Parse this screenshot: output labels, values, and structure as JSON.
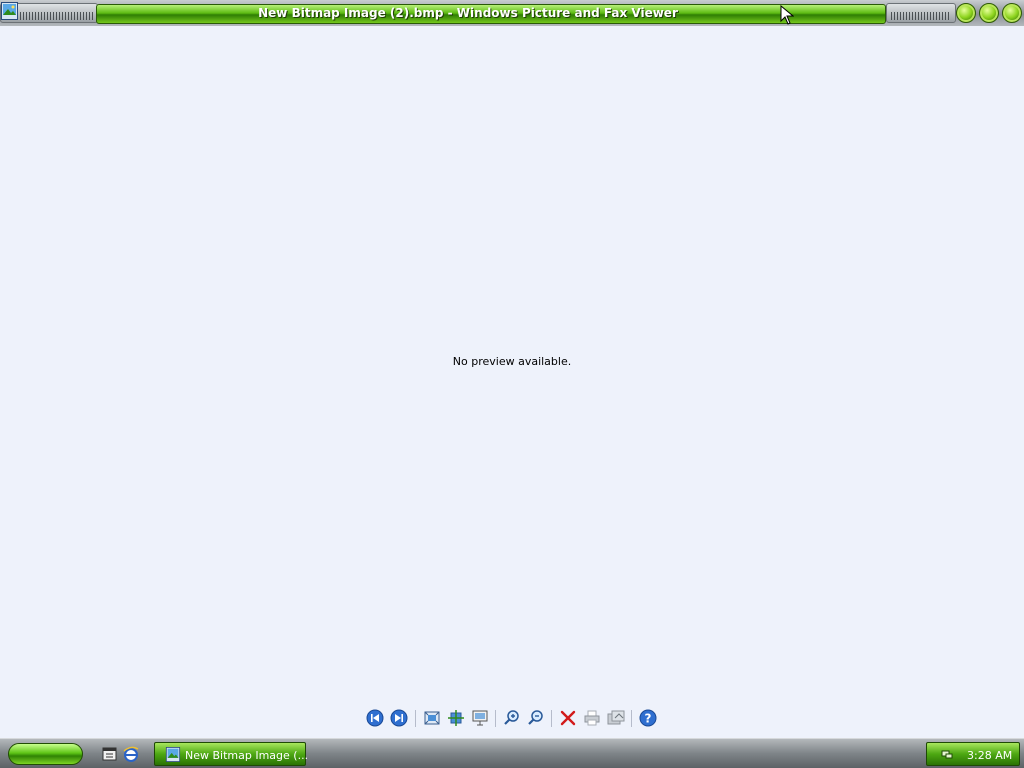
{
  "window": {
    "title": "New Bitmap Image (2).bmp - Windows Picture and Fax Viewer",
    "controls": [
      "minimize",
      "maximize",
      "close"
    ]
  },
  "viewer": {
    "message": "No preview available."
  },
  "toolbar": {
    "buttons": [
      {
        "icon": "previous-image-icon"
      },
      {
        "icon": "next-image-icon"
      },
      {
        "icon": "best-fit-icon"
      },
      {
        "icon": "actual-size-icon"
      },
      {
        "icon": "slideshow-icon"
      },
      {
        "icon": "zoom-in-icon"
      },
      {
        "icon": "zoom-out-icon"
      },
      {
        "icon": "delete-icon"
      },
      {
        "icon": "print-icon"
      },
      {
        "icon": "copy-to-icon"
      },
      {
        "icon": "help-icon"
      }
    ]
  },
  "taskbar": {
    "quick_launch": [
      {
        "icon": "show-desktop-icon"
      },
      {
        "icon": "internet-explorer-icon"
      }
    ],
    "task_button_label": "New Bitmap Image (...",
    "tray_icon": "network-icon",
    "clock": "3:28 AM"
  },
  "colors": {
    "accent_green": "#5dbb12",
    "background": "#eef2fb",
    "taskbar_gray": "#7e8488"
  }
}
